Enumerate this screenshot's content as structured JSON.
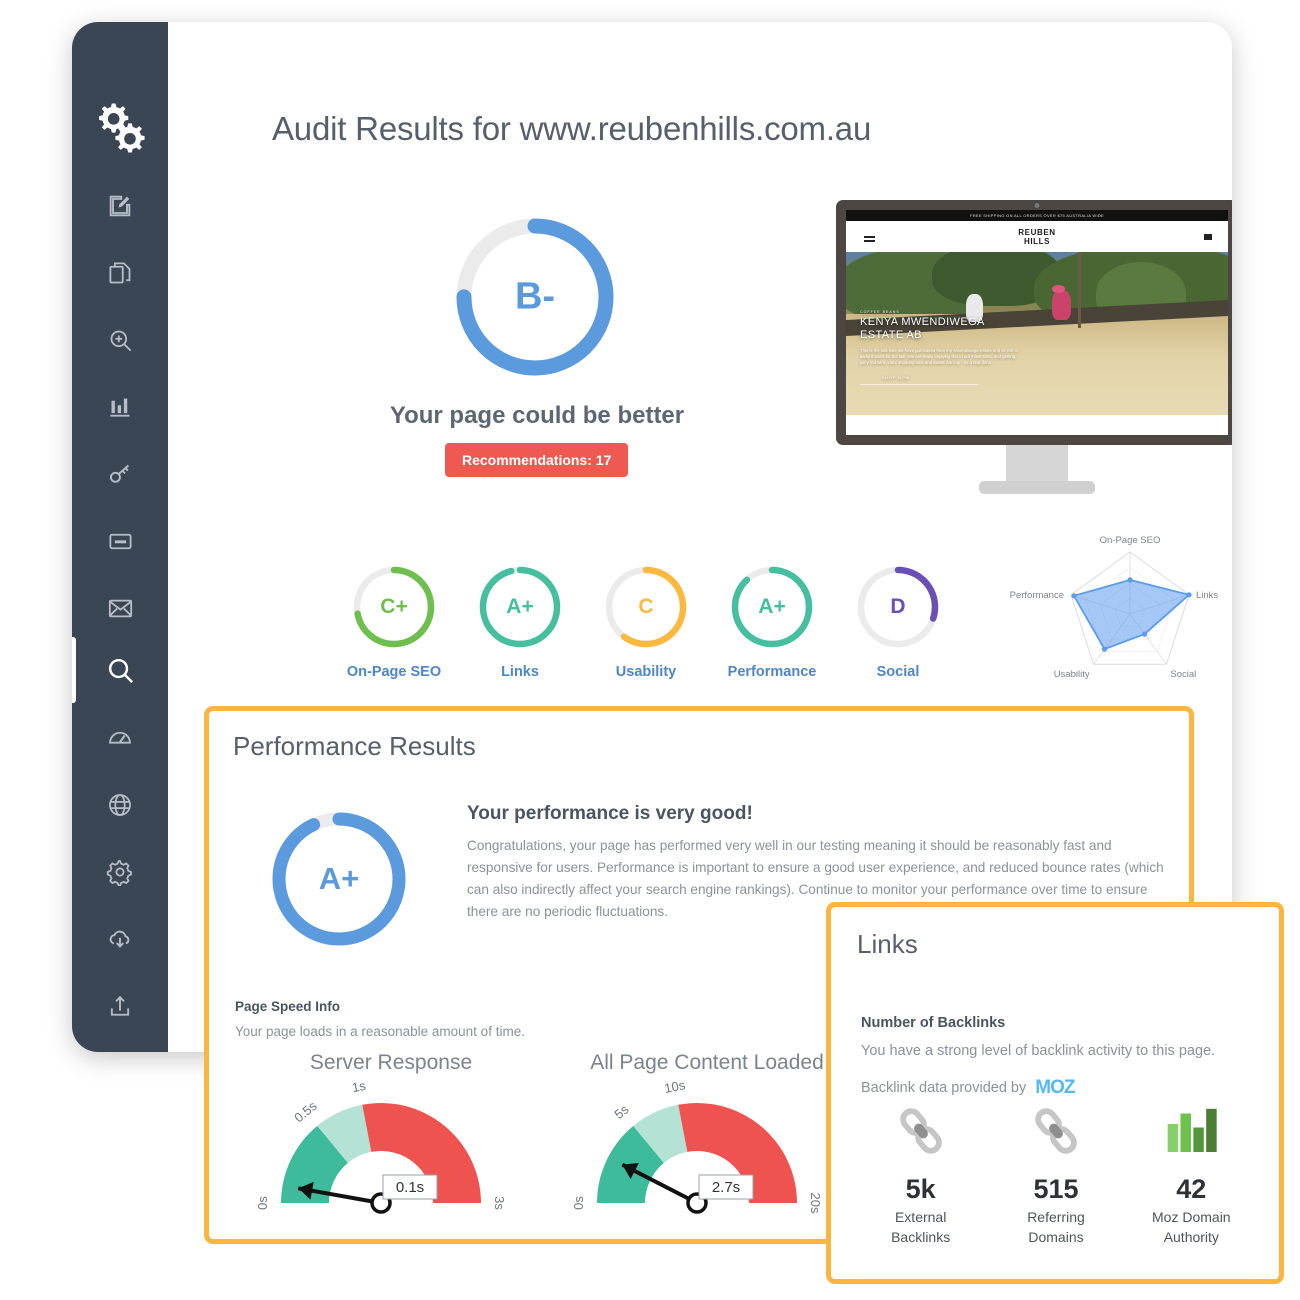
{
  "sidebar": {
    "logo_icon": "gears-logo-icon",
    "items": [
      {
        "icon": "edit-square-icon",
        "name": "edit"
      },
      {
        "icon": "copy-files-icon",
        "name": "reports"
      },
      {
        "icon": "zoom-in-icon",
        "name": "audit"
      },
      {
        "icon": "bar-chart-icon",
        "name": "analytics"
      },
      {
        "icon": "key-icon",
        "name": "keywords"
      },
      {
        "icon": "card-icon",
        "name": "billing"
      },
      {
        "icon": "envelope-icon",
        "name": "email"
      },
      {
        "icon": "search-icon",
        "name": "search",
        "active": true
      },
      {
        "icon": "speedometer-icon",
        "name": "speed"
      },
      {
        "icon": "globe-icon",
        "name": "international"
      },
      {
        "icon": "gear-icon",
        "name": "settings"
      },
      {
        "icon": "cloud-download-icon",
        "name": "download"
      },
      {
        "icon": "upload-icon",
        "name": "upload"
      }
    ]
  },
  "header": {
    "title": "Audit Results for www.reubenhills.com.au"
  },
  "overall": {
    "grade": "B-",
    "percent": 75,
    "color": "#5b9bdd",
    "track_color": "#ebebeb",
    "subtitle": "Your page could be better",
    "recommendations_label": "Recommendations: 17",
    "recommendations_color": "#ee5a52"
  },
  "preview": {
    "topbar_text": "FREE SHIPPING ON ALL ORDERS OVER $75 AUSTRALIA WIDE",
    "brand_line1": "REUBEN",
    "brand_line2": "HILLS",
    "hero_kicker": "COFFEE BEANS",
    "hero_heading_line1": "KENYA MWENDIWEGA",
    "hero_heading_line2": "ESTATE AB",
    "hero_body": "This is the last time we have purchased from the Mwendiwega Estate and its mill is sadly it won't be the last. We are really enjoying this in our Filter Siles, and getting juicy red wine, deni ungaung time and sweet live cup - its a real drink.",
    "hero_link": "SHOP NOW"
  },
  "categories": [
    {
      "label": "On-Page SEO",
      "grade": "C+",
      "percent": 72,
      "color": "#6fbf4f"
    },
    {
      "label": "Links",
      "grade": "A+",
      "percent": 96,
      "color": "#45bfa0"
    },
    {
      "label": "Usability",
      "grade": "C",
      "percent": 60,
      "color": "#fcb940"
    },
    {
      "label": "Performance",
      "grade": "A+",
      "percent": 88,
      "color": "#45bfa0"
    },
    {
      "label": "Social",
      "grade": "D",
      "percent": 30,
      "color": "#6a4fb5"
    }
  ],
  "chart_data": {
    "type": "radar",
    "title": "",
    "categories": [
      "On-Page SEO",
      "Links",
      "Social",
      "Usability",
      "Performance"
    ],
    "values": [
      55,
      100,
      40,
      70,
      95
    ],
    "max": 100,
    "rings": 4,
    "fill_color": "#5b9bf0",
    "fill_opacity": 0.55,
    "grid": true,
    "legend": "none"
  },
  "performance_panel": {
    "title": "Performance Results",
    "grade": "A+",
    "percent": 93,
    "color": "#5b9bdd",
    "headline": "Your performance is very good!",
    "body": "Congratulations, your page has performed very well in our testing meaning it should be reasonably fast and responsive for users. Performance is important to ensure a good user experience, and reduced bounce rates (which can also indirectly affect your search engine rankings). Continue to monitor your performance over time to ensure there are no periodic fluctuations.",
    "page_speed_title": "Page Speed Info",
    "page_speed_sub": "Your page loads in a reasonable amount of time.",
    "gauges": [
      {
        "title": "Server Response",
        "value_label": "0.1s",
        "value": 0.1,
        "ticks": [
          "0s",
          "0.5s",
          "1s",
          "3s"
        ],
        "tick_values": [
          0,
          0.5,
          1,
          3
        ],
        "bands": [
          {
            "to": 0.5,
            "color": "#3dbb9b"
          },
          {
            "to": 1,
            "color": "#b4e3d6"
          },
          {
            "to": 3,
            "color": "#ef5350"
          }
        ]
      },
      {
        "title": "All Page Content Loaded",
        "value_label": "2.7s",
        "value": 2.7,
        "ticks": [
          "0s",
          "5s",
          "10s",
          "20s"
        ],
        "tick_values": [
          0,
          5,
          10,
          20
        ],
        "bands": [
          {
            "to": 5,
            "color": "#3dbb9b"
          },
          {
            "to": 10,
            "color": "#b4e3d6"
          },
          {
            "to": 20,
            "color": "#ef5350"
          }
        ]
      }
    ]
  },
  "links_panel": {
    "title": "Links",
    "sub_title": "Number of Backlinks",
    "sub_desc": "You have a strong level of backlink activity to this page.",
    "provider_label": "Backlink data provided by",
    "provider_name": "MOZ",
    "stats": [
      {
        "icon": "chain-link-icon",
        "value": "5k",
        "label_line1": "External",
        "label_line2": "Backlinks"
      },
      {
        "icon": "chain-link-icon",
        "value": "515",
        "label_line1": "Referring",
        "label_line2": "Domains"
      },
      {
        "icon": "green-bar-chart-icon",
        "value": "42",
        "label_line1": "Moz Domain",
        "label_line2": "Authority"
      }
    ]
  }
}
